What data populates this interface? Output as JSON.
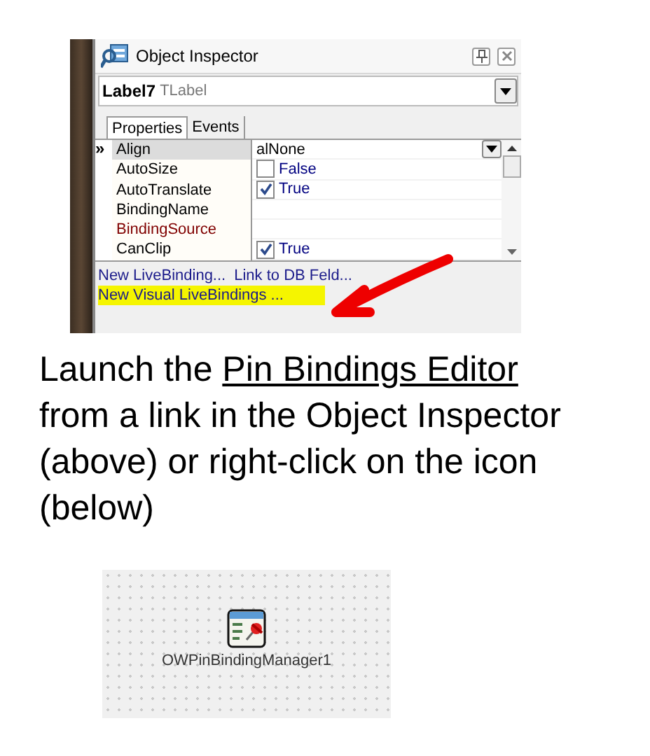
{
  "inspector": {
    "title": "Object Inspector",
    "component": {
      "name": "Label7",
      "type": "TLabel"
    },
    "tabs": [
      {
        "label": "Properties",
        "selected": true
      },
      {
        "label": "Events",
        "selected": false
      }
    ],
    "marker": "»",
    "rows": [
      {
        "name": "Align",
        "kind": "enum",
        "value": "alNone",
        "selected": true,
        "color": "#000000"
      },
      {
        "name": "AutoSize",
        "kind": "bool",
        "value": "False",
        "checked": false,
        "selected": false,
        "color": "#000000"
      },
      {
        "name": "AutoTranslate",
        "kind": "bool",
        "value": "True",
        "checked": true,
        "selected": false,
        "color": "#000000"
      },
      {
        "name": "BindingName",
        "kind": "text",
        "selected": false,
        "color": "#000000"
      },
      {
        "name": "BindingSource",
        "kind": "text",
        "selected": false,
        "color": "#800000"
      },
      {
        "name": "CanClip",
        "kind": "bool",
        "value": "True",
        "checked": true,
        "selected": false,
        "color": "#000000"
      }
    ],
    "links": [
      [
        {
          "label": "New LiveBinding...",
          "highlighted": false
        },
        {
          "label": "Link to DB Feld...",
          "highlighted": false
        }
      ],
      [
        {
          "label": "New Visual LiveBindings ...",
          "highlighted": true
        }
      ]
    ]
  },
  "caption": {
    "before": "Launch the ",
    "link": "Pin Bindings Editor",
    "after": " from a link in the Object Inspector (above) or right-click on the icon (below)"
  },
  "designer": {
    "component_label": "OWPinBindingManager1"
  }
}
